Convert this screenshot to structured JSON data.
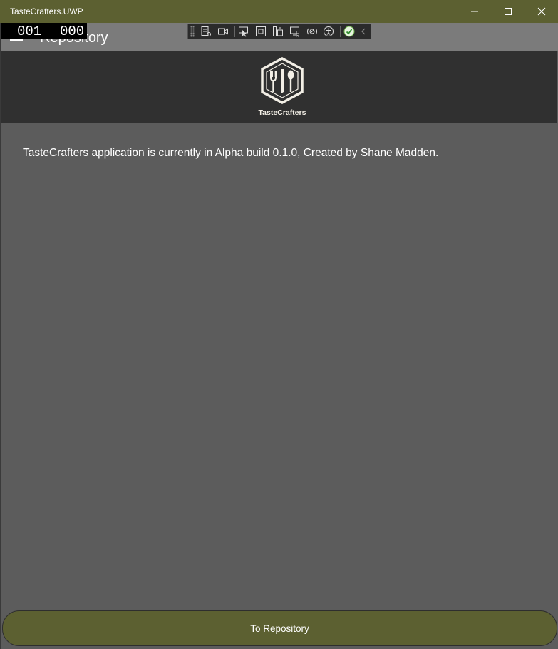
{
  "window": {
    "title": "TasteCrafters.UWP",
    "minimize_icon": "minimize-icon",
    "maximize_icon": "maximize-icon",
    "close_icon": "close-icon",
    "titlebar_color": "#5c6031"
  },
  "page": {
    "title": "Repository",
    "menu_icon": "hamburger-icon"
  },
  "frame_counter": {
    "left": "001",
    "right": "000"
  },
  "dev_toolbar": {
    "buttons": [
      "live-visual-tree-icon",
      "record-icon",
      "select-element-icon",
      "display-layout-adorners-icon",
      "track-focus-icon",
      "bind-failures-icon",
      "hot-reload-icon",
      "accessibility-icon",
      "status-ok-icon",
      "collapse-chevron-icon"
    ]
  },
  "banner": {
    "logo_text": "TasteCrafters"
  },
  "content": {
    "info": "TasteCrafters application is currently in Alpha build 0.1.0, Created by Shane Madden."
  },
  "actions": {
    "to_repository_label": "To Repository"
  }
}
